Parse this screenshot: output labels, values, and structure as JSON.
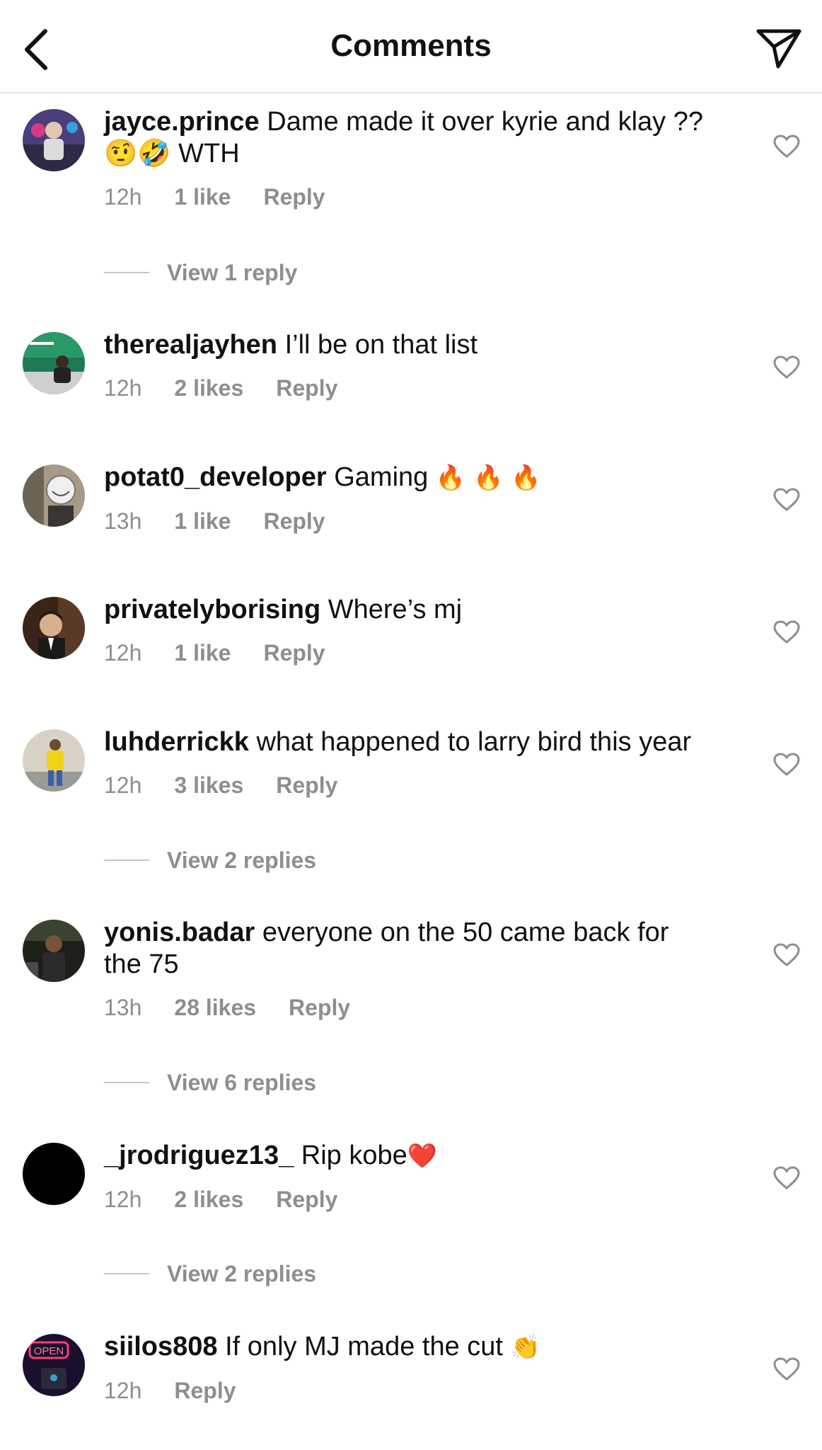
{
  "header": {
    "title": "Comments",
    "back_icon": "chevron-left-icon",
    "share_icon": "paper-plane-icon"
  },
  "comments": [
    {
      "username": "jayce.prince",
      "text": "Dame made it over kyrie and klay ??",
      "text2": "🤨🤣 WTH",
      "time": "12h",
      "likes": "1 like",
      "reply": "Reply",
      "view_replies": "View 1 reply"
    },
    {
      "username": "therealjayhen",
      "text": "I’ll be on that list",
      "time": "12h",
      "likes": "2 likes",
      "reply": "Reply"
    },
    {
      "username": "potat0_developer",
      "text": "Gaming",
      "emoji": "🔥 🔥 🔥",
      "time": "13h",
      "likes": "1 like",
      "reply": "Reply"
    },
    {
      "username": "privatelyborising",
      "text": "Where’s mj",
      "time": "12h",
      "likes": "1 like",
      "reply": "Reply"
    },
    {
      "username": "luhderrickk",
      "text": "what happened to larry bird this year",
      "time": "12h",
      "likes": "3 likes",
      "reply": "Reply",
      "view_replies": "View 2 replies"
    },
    {
      "username": "yonis.badar",
      "text": "everyone on the 50 came back for",
      "text2": "the 75",
      "time": "13h",
      "likes": "28 likes",
      "reply": "Reply",
      "view_replies": "View 6 replies"
    },
    {
      "username": "_jrodriguez13_",
      "text": "Rip kobe",
      "emoji": "❤️",
      "time": "12h",
      "likes": "2 likes",
      "reply": "Reply",
      "view_replies": "View 2 replies"
    },
    {
      "username": "siilos808",
      "text": "If only MJ made the cut",
      "emoji": "👏",
      "avatar_text": "OPEN",
      "time": "12h",
      "reply": "Reply"
    }
  ],
  "colors": {
    "text": "#111111",
    "secondary": "#8e8e8e",
    "divider": "#e6e6e6"
  }
}
